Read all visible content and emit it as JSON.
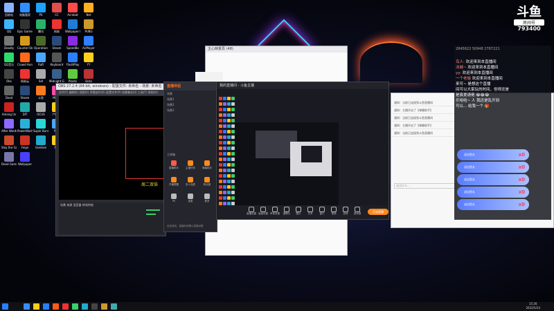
{
  "desktop_icons": [
    {
      "label": "回收站",
      "color": "#8ab4ff"
    },
    {
      "label": "电脑管家",
      "color": "#2f8fff"
    },
    {
      "label": "PS",
      "color": "#1ea2ff"
    },
    {
      "label": "CC",
      "color": "#e04e4e"
    },
    {
      "label": "Acrobat",
      "color": "#ff4a4a"
    },
    {
      "label": "Net",
      "color": "#ffb020"
    },
    {
      "label": "QQ",
      "color": "#3db4ff"
    },
    {
      "label": "Epic Games Launcher",
      "color": "#333"
    },
    {
      "label": "腾讯",
      "color": "#2ab26a"
    },
    {
      "label": "网易",
      "color": "#e33"
    },
    {
      "label": "Wallpaper Engine",
      "color": "#1e7bd6"
    },
    {
      "label": "PUBG",
      "color": "#cc9a2a"
    },
    {
      "label": "Deadly",
      "color": "#777"
    },
    {
      "label": "Counter-Strike",
      "color": "#d59a1a"
    },
    {
      "label": "Operation",
      "color": "#4a6a2a"
    },
    {
      "label": "Steam",
      "color": "#2a4b7a"
    },
    {
      "label": "SpeedBo",
      "color": "#8a2be2"
    },
    {
      "label": "AirPlayer",
      "color": "#2f7fff"
    },
    {
      "label": "QQ音乐",
      "color": "#2ddb6a"
    },
    {
      "label": "Crowd Hunger",
      "color": "#ff6a1a"
    },
    {
      "label": "Raft",
      "color": "#4aa7ff"
    },
    {
      "label": "Keyboard",
      "color": "#555"
    },
    {
      "label": "FlashPlay",
      "color": "#2a7fff"
    },
    {
      "label": "YY",
      "color": "#ffd01a"
    },
    {
      "label": "Obs",
      "color": "#444"
    },
    {
      "label": "网易云",
      "color": "#e33"
    },
    {
      "label": "Sdl",
      "color": "#aaa"
    },
    {
      "label": "Midnight Ghost Hunt",
      "color": "#3a5f8a"
    },
    {
      "label": "Plants",
      "color": "#5fc93f"
    },
    {
      "label": "Dota",
      "color": "#b33"
    },
    {
      "label": "Dead",
      "color": "#666"
    },
    {
      "label": "Steam",
      "color": "#2a4b7a"
    },
    {
      "label": "斗鱼",
      "color": "#ff7a1e"
    },
    {
      "label": "Mirror",
      "color": "#ff4aa8"
    },
    {
      "label": "Bloons TD 6",
      "color": "#e33"
    },
    {
      "label": "Internet Explorer",
      "color": "#2f9bff"
    },
    {
      "label": "Among Us",
      "color": "#c22"
    },
    {
      "label": "DIT",
      "color": "#2aa"
    },
    {
      "label": "OCUS",
      "color": "#aaa"
    },
    {
      "label": "YY语音",
      "color": "#ffcc1a"
    },
    {
      "label": "Cook Game",
      "color": "#d76a2a"
    },
    {
      "label": "人类一败涂地",
      "color": "#2a8fff"
    },
    {
      "label": "After Words",
      "color": "#8a6aff"
    },
    {
      "label": "PowerWash Simulator",
      "color": "#2ab0d6"
    },
    {
      "label": "Super Bunny Man",
      "color": "#2ad6d6"
    },
    {
      "label": "Raft",
      "color": "#4aa7ff"
    },
    {
      "label": "Super",
      "color": "#2a7fff"
    },
    {
      "label": "OBS Studio",
      "color": "#444"
    },
    {
      "label": "Slay the Game",
      "color": "#c94a2a"
    },
    {
      "label": "Feign",
      "color": "#c32"
    },
    {
      "label": "GeeGee",
      "color": "#2ac"
    },
    {
      "label": "Fed",
      "color": "#fc2"
    },
    {
      "label": "冒险小镇",
      "color": "#f93"
    },
    {
      "label": "YY",
      "color": "#ffd01a"
    },
    {
      "label": "Dead Game",
      "color": "#77a"
    },
    {
      "label": "Wallpaper",
      "color": "#4a3fff"
    }
  ],
  "obs": {
    "title": "OBS 27.2.4 (64-bit, windows) - 配置文件: 未命名 - 场景: 未命名",
    "menu": "文件(F)  编辑(E)  视图(V)  停靠部件(D)  配置文件(P)  场景集合(S)  工具(T)  帮助(H)",
    "overlay_text": "周二双倍",
    "dock_title": "场景  来源  混音器  转场特效"
  },
  "tool": {
    "app_name": "直播伴侣",
    "tabs": [
      "场景",
      "素材"
    ],
    "side_items": [
      "场景1",
      "场景2",
      "场景3"
    ],
    "label": "工具箱",
    "tools": [
      {
        "label": "直播助手",
        "color": "#ff5a4a"
      },
      {
        "label": "主播任务",
        "color": "#ff8a1a"
      },
      {
        "label": "弹幕助手",
        "color": "#ff8a1a"
      },
      {
        "label": "开播提醒",
        "color": "#ff8a1a"
      },
      {
        "label": "多人连麦",
        "color": "#ff8a1a"
      },
      {
        "label": "粉丝团",
        "color": "#ff8a1a"
      },
      {
        "label": "PK",
        "color": "#bbb"
      },
      {
        "label": "连麦",
        "color": "#bbb"
      },
      {
        "label": "更多",
        "color": "#bbb"
      }
    ],
    "footer": "欢迎使用，直播前请确认直播设置"
  },
  "studio": {
    "title": "我的直播间 - 斗鱼主播",
    "window_title": "主心映景頁 (48)",
    "buttons": [
      "直播设置",
      "高级设置",
      "声音设置",
      "摄像头",
      "图片",
      "文本",
      "窗口",
      "视频",
      "游戏",
      "游戏源"
    ],
    "start_live_label": "开始直播"
  },
  "chatwin": {
    "rows": [
      "通知：当前已连接到斗鱼直播间",
      "通知：主播开启了【弹幕助手】",
      "通知：当前已连接到斗鱼直播间",
      "通知：主播开启了【弹幕助手】",
      "通知：当前已连接到斗鱼直播间"
    ],
    "input_placeholder": "说点什么..."
  },
  "overlay": {
    "stats": "2845622   50948   2787221",
    "comments": [
      {
        "user": "鸟人:",
        "text": "欢迎来到本直播间"
      },
      {
        "user": "冰城~",
        "text": "欢迎来到本直播间"
      },
      {
        "user": "yy:",
        "text": "欢迎来到本直播间"
      },
      {
        "user": "一个老姐",
        "text": "欢迎来到本直播间"
      },
      {
        "user": "",
        "text": "来可~ 是想这个直播"
      },
      {
        "user": "",
        "text": "间可以大家玩的时间，但得还是"
      },
      {
        "user": "",
        "text": "是真爱请佬 😂😂😂"
      },
      {
        "user": "",
        "text": "乐哈哈~ 人 我还是乱开到"
      },
      {
        "user": "",
        "text": "可以... 给我一个 🎁"
      }
    ],
    "gifts": [
      {
        "name": "送出鱼丸",
        "count": "x0"
      },
      {
        "name": "送出鱼丸",
        "count": "x0"
      },
      {
        "name": "送出鱼丸",
        "count": "x0"
      },
      {
        "name": "送出鱼丸",
        "count": "x0"
      },
      {
        "name": "送出鱼丸",
        "count": "x0"
      }
    ]
  },
  "logo": {
    "big": "斗鱼",
    "small": "房间号",
    "room": "793400"
  },
  "taskbar": {
    "time": "15:26",
    "date": "2022/5/24",
    "icons": [
      "#3a8dff",
      "#ffcc1a",
      "#2a7fff",
      "#ff5a1a",
      "#e33",
      "#3ad06a",
      "#2ac",
      "#444",
      "#c93",
      "#4aa"
    ]
  }
}
